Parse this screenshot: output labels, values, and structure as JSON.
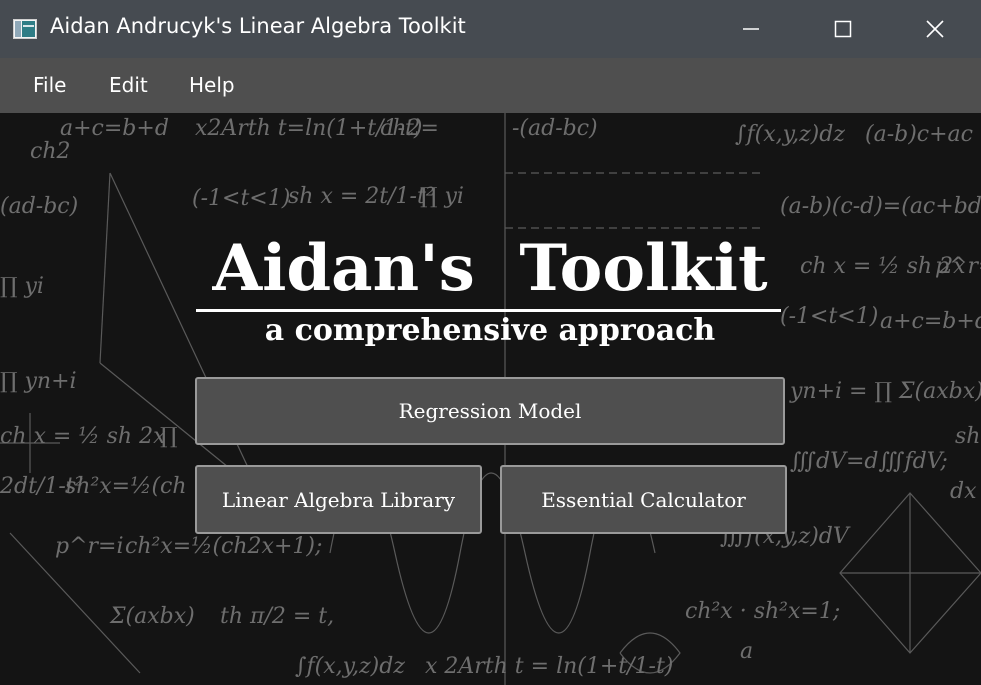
{
  "window": {
    "title": "Aidan Andrucyk's Linear Algebra Toolkit",
    "icon": "app-window-icon",
    "controls": [
      "minimize-icon",
      "maximize-icon",
      "close-icon"
    ]
  },
  "menu": {
    "items": [
      {
        "label": "File"
      },
      {
        "label": "Edit"
      },
      {
        "label": "Help"
      }
    ]
  },
  "main": {
    "title": "Aidan's  Toolkit",
    "subtitle": "a comprehensive approach",
    "buttons": {
      "regression": "Regression Model",
      "linear_algebra": "Linear Algebra Library",
      "calculator": "Essential Calculator"
    }
  },
  "background": {
    "formulas": [
      "a+c=b+d",
      "x2Arth t=ln(1+t/1-t)",
      "ch2",
      "-(ad-bc)",
      "∫f(x,y,z)dz",
      "(a-b)c+ac",
      "(ad-bc)",
      "(-1<t<1)",
      "sh x = 2t/1-t²",
      "∏ yi",
      "(a-b)(c-d)=(ac+bd)",
      "∏ yi",
      "ch x = ½ sh 2x",
      "p^r=i",
      "(-1<t<1)",
      "a+c=b+d",
      "∏ yn+i",
      "∏ Σ(axbx)",
      "ch x = ½ sh 2x",
      "∏",
      "∭dV=d∭fdV;",
      "sh",
      "2dt/1-t²",
      "sh²x=½(ch 2x",
      "dx",
      "p^r=i",
      "ch²x=½(ch2x+1);",
      "∭f(x,y,z)dV",
      "Σ(axbx)",
      "th π/2 = t,",
      "ch²x · sh²x=1;",
      "∫f(x,y,z)dz",
      "x 2Arth t = ln(1+t/1-t)",
      "a"
    ]
  },
  "colors": {
    "titlebar": "#464b51",
    "menubar": "#4f4f4f",
    "background": "#141414",
    "button": "#4f4f4f",
    "button_border": "#9a9a9a",
    "chalk": "#6e6e6e"
  }
}
